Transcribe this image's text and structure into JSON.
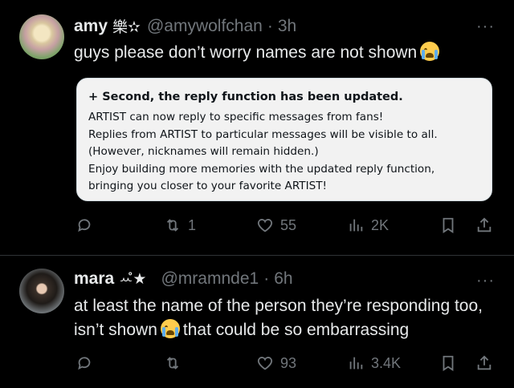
{
  "posts": [
    {
      "name": "amy",
      "badge": "樂✫",
      "handle": "@amywolfchan",
      "dot": "·",
      "time": "3h",
      "text_before": "guys please don’t worry names are not shown",
      "text_after": "",
      "emoji_icon": "crying-face",
      "card": {
        "heading": "+ Second, the reply function has been updated.",
        "lines": [
          "ARTIST can now reply to specific messages from fans!",
          "Replies from ARTIST to particular messages will be visible to all.",
          "(However, nicknames will remain hidden.)",
          "Enjoy building more memories with the updated reply function, bringing you closer to your favorite ARTIST!"
        ]
      },
      "actions": {
        "reply": "",
        "repost": "1",
        "like": "55",
        "views": "2K"
      }
    },
    {
      "name": "mara",
      "badge": "ꕀ̊★",
      "handle": "@mramnde1",
      "dot": "·",
      "time": "6h",
      "text_before": "at least the name of the person they’re responding too, isn’t shown",
      "text_after": "that could be so embarrassing",
      "emoji_icon": "crying-face",
      "actions": {
        "reply": "",
        "repost": "",
        "like": "93",
        "views": "3.4K"
      }
    }
  ],
  "more_label": "···",
  "colors": {
    "background": "#000000",
    "text": "#e7e9ea",
    "muted": "#71767b",
    "card": "#f2f2f2"
  }
}
